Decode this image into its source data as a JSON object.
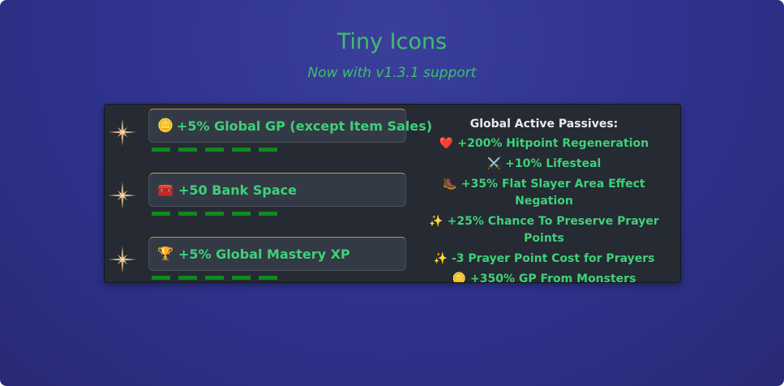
{
  "header": {
    "title": "Tiny Icons",
    "subtitle": "Now with v1.3.1 support"
  },
  "modifiers": [
    {
      "icon": "coins-icon",
      "glyph": "🪙",
      "label": "+5% Global GP (except Item Sales)"
    },
    {
      "icon": "treasure-chest-icon",
      "glyph": "🧰",
      "label": "+50 Bank Space"
    },
    {
      "icon": "trophy-icon",
      "glyph": "🏆",
      "label": "+5% Global Mastery XP"
    }
  ],
  "passives": {
    "title": "Global Active Passives:",
    "items": [
      {
        "icon": "heart-icon",
        "glyph": "❤️",
        "label": "+200% Hitpoint Regeneration"
      },
      {
        "icon": "crossed-swords-icon",
        "glyph": "⚔️",
        "label": "+10% Lifesteal"
      },
      {
        "icon": "slayer-boot-icon",
        "glyph": "🥾",
        "label": "+35% Flat Slayer Area Effect Negation"
      },
      {
        "icon": "prayer-sparkle-icon",
        "glyph": "✨",
        "label": "+25% Chance To Preserve Prayer Points"
      },
      {
        "icon": "prayer-sparkle-icon",
        "glyph": "✨",
        "label": "-3 Prayer Point Cost for Prayers"
      },
      {
        "icon": "coins-icon",
        "glyph": "🪙",
        "label": "+350% GP From Monsters"
      }
    ]
  },
  "colors": {
    "accent_green": "#3fd07a",
    "dash_green": "#0e8a1e",
    "box_border_gold": "#c49a3a",
    "background": "#303490"
  }
}
